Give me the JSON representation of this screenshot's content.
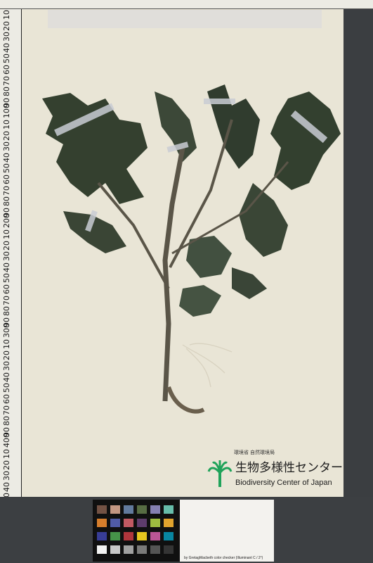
{
  "ruler": {
    "labels": [
      "10",
      "20",
      "30",
      "40",
      "50",
      "60",
      "70",
      "80",
      "90",
      "100",
      "10",
      "20",
      "30",
      "40",
      "50",
      "60",
      "70",
      "80",
      "90",
      "200",
      "10",
      "20",
      "30",
      "40",
      "50",
      "60",
      "70",
      "80",
      "90",
      "300",
      "10",
      "20",
      "30",
      "40",
      "50",
      "60",
      "70",
      "80",
      "90",
      "400",
      "10",
      "20",
      "30",
      "40",
      "50",
      "60",
      "70",
      "80",
      "90",
      "500"
    ]
  },
  "logo": {
    "small_text": "環境省 自然環境局",
    "main_text": "生物多様性センター",
    "english_text": "Biodiversity Center of Japan"
  },
  "color_card": {
    "caption": "by GretagMacbeth color checker (Illuminant C / 2°)"
  },
  "colors": {
    "sheet": "#e9e5d6",
    "leaf_dark": "#2f3b30",
    "leaf_mid": "#4b5a48",
    "stem": "#5a5548",
    "logo_green": "#1fa35a"
  }
}
